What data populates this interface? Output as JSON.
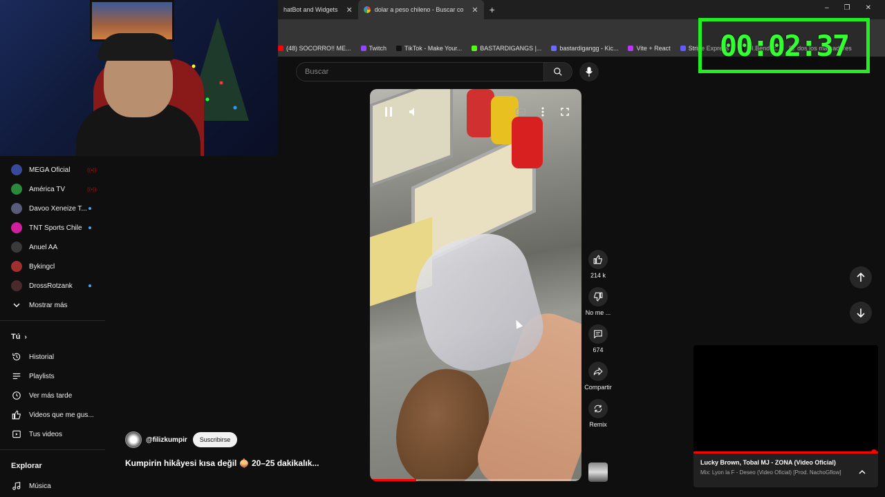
{
  "browser": {
    "tabs": [
      {
        "label": "hatBot and Widgets",
        "active": false
      },
      {
        "label": "dolar a peso chileno - Buscar co",
        "active": true
      }
    ],
    "new_tab": "+",
    "window_controls": [
      "–",
      "❐",
      "✕"
    ],
    "bookmarks": [
      {
        "label": "(48) SOCORRO!! ME...",
        "color": "#ff0000"
      },
      {
        "label": "Twitch",
        "color": "#9146ff"
      },
      {
        "label": "TikTok - Make Your...",
        "color": "#111111"
      },
      {
        "label": "BASTARDIGANGS |...",
        "color": "#53fc18"
      },
      {
        "label": "bastardigangg - Kic...",
        "color": "#6a6aff"
      },
      {
        "label": "Vite + React",
        "color": "#bd34fe"
      },
      {
        "label": "Stripe Express",
        "color": "#635bff"
      },
      {
        "label": "fpl.Benditc..",
        "color": "#111111"
      },
      {
        "label": "dos los marcadores",
        "color": "#888888"
      }
    ]
  },
  "youtube": {
    "search_placeholder": "Buscar",
    "subscriptions": [
      {
        "label": "MEGA Oficial",
        "status": "live",
        "color": "#3a4a9a"
      },
      {
        "label": "América TV",
        "status": "live",
        "color": "#2a8a3a"
      },
      {
        "label": "Davoo Xeneize T...",
        "status": "new",
        "color": "#5a5a7a"
      },
      {
        "label": "TNT Sports Chile",
        "status": "new",
        "color": "#d020a0"
      },
      {
        "label": "Anuel AA",
        "status": "",
        "color": "#3a3a3a"
      },
      {
        "label": "Bykingcl",
        "status": "",
        "color": "#a03030"
      },
      {
        "label": "DrossRotzank",
        "status": "new",
        "color": "#4a2a2a"
      }
    ],
    "show_more": "Mostrar más",
    "you_section": "Tú",
    "you_items": [
      {
        "label": "Historial",
        "icon": "history-icon"
      },
      {
        "label": "Playlists",
        "icon": "playlist-icon"
      },
      {
        "label": "Ver más tarde",
        "icon": "clock-icon"
      },
      {
        "label": "Videos que me gus...",
        "icon": "thumbs-up-icon"
      },
      {
        "label": "Tus videos",
        "icon": "video-icon"
      }
    ],
    "explore_section": "Explorar",
    "explore_items": [
      {
        "label": "Música",
        "icon": "music-icon"
      }
    ]
  },
  "short": {
    "channel": "@filizkumpir",
    "subscribe": "Suscribirse",
    "title": "Kumpirin hikâyesi kısa değil 🧅 20–25 dakikalık...",
    "progress": 0.22,
    "likes": "214 k",
    "dislike_label": "No me ...",
    "comments": "674",
    "share_label": "Compartir",
    "remix_label": "Remix"
  },
  "timer": {
    "display": "00:02:37",
    "color": "#33ff33"
  },
  "mini_player": {
    "title": "Lucky Brown, Tobal MJ - ZONA (Video Oficial)",
    "subtitle": "Mix: Lyon la F - Deseo (Video Oficial) [Prod. NachoGflow]",
    "progress": 0.99
  }
}
